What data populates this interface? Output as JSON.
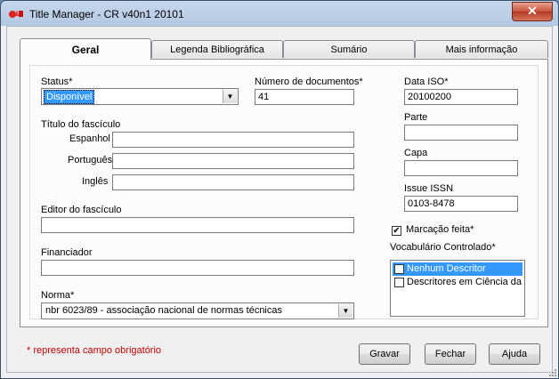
{
  "window": {
    "title": "Title Manager - CR v40n1 20101",
    "close_label": "✕"
  },
  "tabs": [
    {
      "label": "Geral",
      "active": true
    },
    {
      "label": "Legenda Bibliográfica",
      "active": false
    },
    {
      "label": "Sumário",
      "active": false
    },
    {
      "label": "Mais informação",
      "active": false
    }
  ],
  "form": {
    "status": {
      "label": "Status*",
      "value": "Disponível"
    },
    "num_docs": {
      "label": "Número de documentos*",
      "value": "41"
    },
    "data_iso": {
      "label": "Data ISO*",
      "value": "20100200"
    },
    "titulo_fasciculo": {
      "label": "Título do fascículo",
      "espanhol": {
        "label": "Espanhol",
        "value": ""
      },
      "portugues": {
        "label": "Português",
        "value": ""
      },
      "ingles": {
        "label": "Inglês",
        "value": ""
      }
    },
    "parte": {
      "label": "Parte",
      "value": ""
    },
    "capa": {
      "label": "Capa",
      "value": ""
    },
    "issue_issn": {
      "label": "Issue ISSN",
      "value": "0103-8478"
    },
    "editor": {
      "label": "Editor do fascículo",
      "value": ""
    },
    "marcacao": {
      "label": "Marcação feita*",
      "checked": true
    },
    "financiador": {
      "label": "Financiador",
      "value": ""
    },
    "vocabulario": {
      "label": "Vocabulário Controlado*",
      "items": [
        {
          "label": "Nenhum Descritor",
          "checked": true,
          "selected": true
        },
        {
          "label": "Descritores em Ciência da S",
          "checked": false,
          "selected": false
        }
      ]
    },
    "norma": {
      "label": "Norma*",
      "value": "nbr 6023/89 - associação nacional de normas técnicas"
    }
  },
  "footer": {
    "note": "* representa campo obrigatório",
    "buttons": {
      "gravar": "Gravar",
      "fechar": "Fechar",
      "ajuda": "Ajuda"
    }
  },
  "colors": {
    "selection": "#3399ff",
    "required_note": "#c00000",
    "close_button": "#c8513b"
  }
}
